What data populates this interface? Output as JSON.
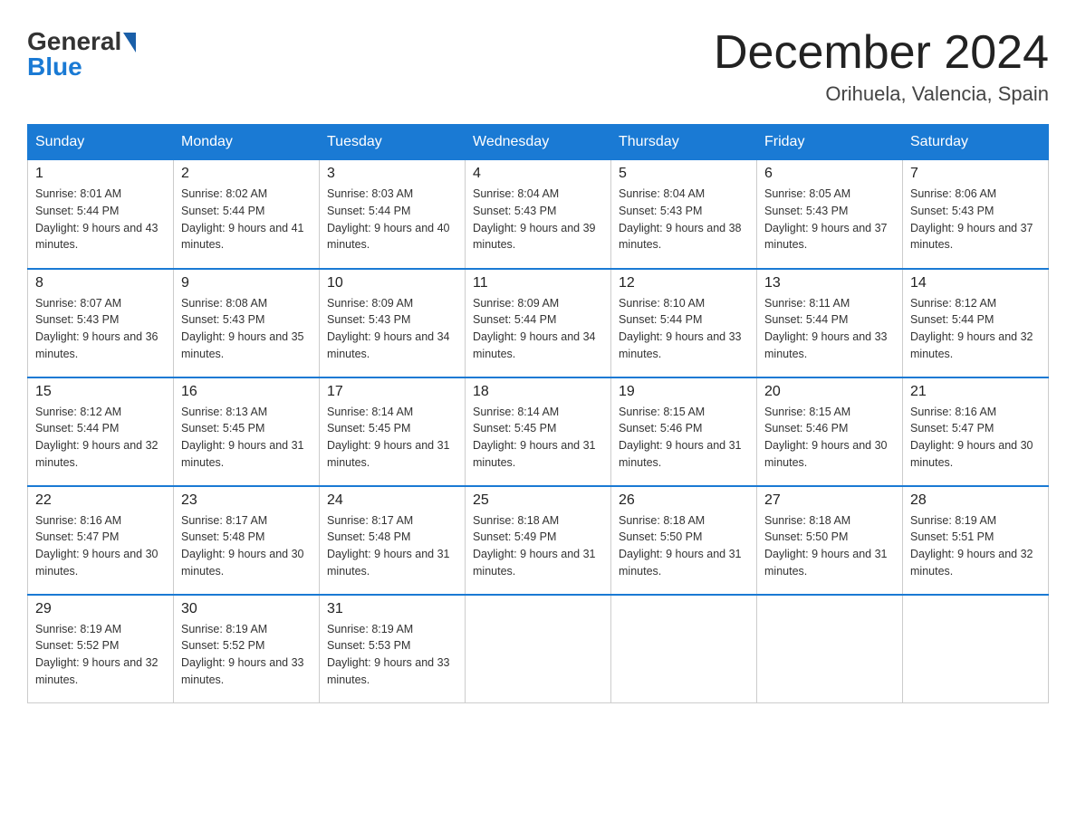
{
  "header": {
    "logo_general": "General",
    "logo_blue": "Blue",
    "month_title": "December 2024",
    "location": "Orihuela, Valencia, Spain"
  },
  "days_of_week": [
    "Sunday",
    "Monday",
    "Tuesday",
    "Wednesday",
    "Thursday",
    "Friday",
    "Saturday"
  ],
  "weeks": [
    [
      {
        "day": "1",
        "sunrise": "8:01 AM",
        "sunset": "5:44 PM",
        "daylight": "9 hours and 43 minutes."
      },
      {
        "day": "2",
        "sunrise": "8:02 AM",
        "sunset": "5:44 PM",
        "daylight": "9 hours and 41 minutes."
      },
      {
        "day": "3",
        "sunrise": "8:03 AM",
        "sunset": "5:44 PM",
        "daylight": "9 hours and 40 minutes."
      },
      {
        "day": "4",
        "sunrise": "8:04 AM",
        "sunset": "5:43 PM",
        "daylight": "9 hours and 39 minutes."
      },
      {
        "day": "5",
        "sunrise": "8:04 AM",
        "sunset": "5:43 PM",
        "daylight": "9 hours and 38 minutes."
      },
      {
        "day": "6",
        "sunrise": "8:05 AM",
        "sunset": "5:43 PM",
        "daylight": "9 hours and 37 minutes."
      },
      {
        "day": "7",
        "sunrise": "8:06 AM",
        "sunset": "5:43 PM",
        "daylight": "9 hours and 37 minutes."
      }
    ],
    [
      {
        "day": "8",
        "sunrise": "8:07 AM",
        "sunset": "5:43 PM",
        "daylight": "9 hours and 36 minutes."
      },
      {
        "day": "9",
        "sunrise": "8:08 AM",
        "sunset": "5:43 PM",
        "daylight": "9 hours and 35 minutes."
      },
      {
        "day": "10",
        "sunrise": "8:09 AM",
        "sunset": "5:43 PM",
        "daylight": "9 hours and 34 minutes."
      },
      {
        "day": "11",
        "sunrise": "8:09 AM",
        "sunset": "5:44 PM",
        "daylight": "9 hours and 34 minutes."
      },
      {
        "day": "12",
        "sunrise": "8:10 AM",
        "sunset": "5:44 PM",
        "daylight": "9 hours and 33 minutes."
      },
      {
        "day": "13",
        "sunrise": "8:11 AM",
        "sunset": "5:44 PM",
        "daylight": "9 hours and 33 minutes."
      },
      {
        "day": "14",
        "sunrise": "8:12 AM",
        "sunset": "5:44 PM",
        "daylight": "9 hours and 32 minutes."
      }
    ],
    [
      {
        "day": "15",
        "sunrise": "8:12 AM",
        "sunset": "5:44 PM",
        "daylight": "9 hours and 32 minutes."
      },
      {
        "day": "16",
        "sunrise": "8:13 AM",
        "sunset": "5:45 PM",
        "daylight": "9 hours and 31 minutes."
      },
      {
        "day": "17",
        "sunrise": "8:14 AM",
        "sunset": "5:45 PM",
        "daylight": "9 hours and 31 minutes."
      },
      {
        "day": "18",
        "sunrise": "8:14 AM",
        "sunset": "5:45 PM",
        "daylight": "9 hours and 31 minutes."
      },
      {
        "day": "19",
        "sunrise": "8:15 AM",
        "sunset": "5:46 PM",
        "daylight": "9 hours and 31 minutes."
      },
      {
        "day": "20",
        "sunrise": "8:15 AM",
        "sunset": "5:46 PM",
        "daylight": "9 hours and 30 minutes."
      },
      {
        "day": "21",
        "sunrise": "8:16 AM",
        "sunset": "5:47 PM",
        "daylight": "9 hours and 30 minutes."
      }
    ],
    [
      {
        "day": "22",
        "sunrise": "8:16 AM",
        "sunset": "5:47 PM",
        "daylight": "9 hours and 30 minutes."
      },
      {
        "day": "23",
        "sunrise": "8:17 AM",
        "sunset": "5:48 PM",
        "daylight": "9 hours and 30 minutes."
      },
      {
        "day": "24",
        "sunrise": "8:17 AM",
        "sunset": "5:48 PM",
        "daylight": "9 hours and 31 minutes."
      },
      {
        "day": "25",
        "sunrise": "8:18 AM",
        "sunset": "5:49 PM",
        "daylight": "9 hours and 31 minutes."
      },
      {
        "day": "26",
        "sunrise": "8:18 AM",
        "sunset": "5:50 PM",
        "daylight": "9 hours and 31 minutes."
      },
      {
        "day": "27",
        "sunrise": "8:18 AM",
        "sunset": "5:50 PM",
        "daylight": "9 hours and 31 minutes."
      },
      {
        "day": "28",
        "sunrise": "8:19 AM",
        "sunset": "5:51 PM",
        "daylight": "9 hours and 32 minutes."
      }
    ],
    [
      {
        "day": "29",
        "sunrise": "8:19 AM",
        "sunset": "5:52 PM",
        "daylight": "9 hours and 32 minutes."
      },
      {
        "day": "30",
        "sunrise": "8:19 AM",
        "sunset": "5:52 PM",
        "daylight": "9 hours and 33 minutes."
      },
      {
        "day": "31",
        "sunrise": "8:19 AM",
        "sunset": "5:53 PM",
        "daylight": "9 hours and 33 minutes."
      },
      null,
      null,
      null,
      null
    ]
  ]
}
